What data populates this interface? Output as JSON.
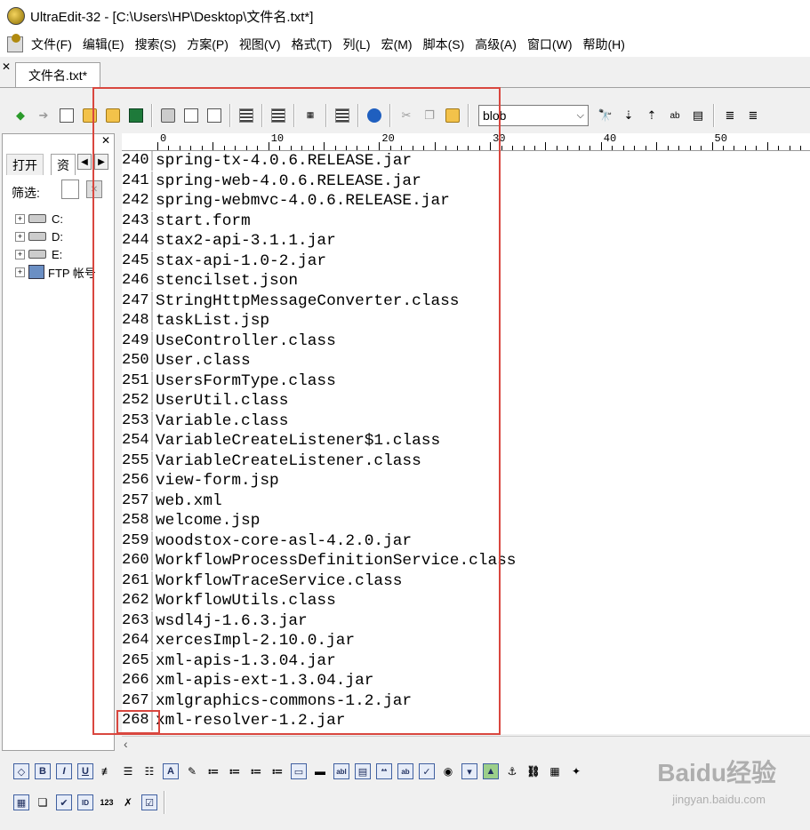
{
  "window": {
    "title": "UltraEdit-32 - [C:\\Users\\HP\\Desktop\\文件名.txt*]"
  },
  "menu": [
    "文件(F)",
    "编辑(E)",
    "搜索(S)",
    "方案(P)",
    "视图(V)",
    "格式(T)",
    "列(L)",
    "宏(M)",
    "脚本(S)",
    "高级(A)",
    "窗口(W)",
    "帮助(H)"
  ],
  "tab": {
    "label": "文件名.txt*"
  },
  "toolbar": {
    "search_value": "blob"
  },
  "left_panel": {
    "tab_open": "打开",
    "tab_resource": "资",
    "filter_label": "筛选:",
    "tree": [
      {
        "label": "C:",
        "icon": "drive-icon"
      },
      {
        "label": "D:",
        "icon": "drive-icon"
      },
      {
        "label": "E:",
        "icon": "drive-icon"
      },
      {
        "label": "FTP 帐号",
        "icon": "ftp-icon"
      }
    ]
  },
  "ruler": {
    "marks": [
      "0",
      "10",
      "20",
      "30",
      "40",
      "50"
    ]
  },
  "editor": {
    "lines": [
      {
        "num": "240",
        "text": "spring-tx-4.0.6.RELEASE.jar"
      },
      {
        "num": "241",
        "text": "spring-web-4.0.6.RELEASE.jar"
      },
      {
        "num": "242",
        "text": "spring-webmvc-4.0.6.RELEASE.jar"
      },
      {
        "num": "243",
        "text": "start.form"
      },
      {
        "num": "244",
        "text": "stax2-api-3.1.1.jar"
      },
      {
        "num": "245",
        "text": "stax-api-1.0-2.jar"
      },
      {
        "num": "246",
        "text": "stencilset.json"
      },
      {
        "num": "247",
        "text": "StringHttpMessageConverter.class"
      },
      {
        "num": "248",
        "text": "taskList.jsp"
      },
      {
        "num": "249",
        "text": "UseController.class"
      },
      {
        "num": "250",
        "text": "User.class"
      },
      {
        "num": "251",
        "text": "UsersFormType.class"
      },
      {
        "num": "252",
        "text": "UserUtil.class"
      },
      {
        "num": "253",
        "text": "Variable.class"
      },
      {
        "num": "254",
        "text": "VariableCreateListener$1.class"
      },
      {
        "num": "255",
        "text": "VariableCreateListener.class"
      },
      {
        "num": "256",
        "text": "view-form.jsp"
      },
      {
        "num": "257",
        "text": "web.xml"
      },
      {
        "num": "258",
        "text": "welcome.jsp"
      },
      {
        "num": "259",
        "text": "woodstox-core-asl-4.2.0.jar"
      },
      {
        "num": "260",
        "text": "WorkflowProcessDefinitionService.class"
      },
      {
        "num": "261",
        "text": "WorkflowTraceService.class"
      },
      {
        "num": "262",
        "text": "WorkflowUtils.class"
      },
      {
        "num": "263",
        "text": "wsdl4j-1.6.3.jar"
      },
      {
        "num": "264",
        "text": "xercesImpl-2.10.0.jar"
      },
      {
        "num": "265",
        "text": "xml-apis-1.3.04.jar"
      },
      {
        "num": "266",
        "text": "xml-apis-ext-1.3.04.jar"
      },
      {
        "num": "267",
        "text": "xmlgraphics-commons-1.2.jar"
      },
      {
        "num": "268",
        "text": "xml-resolver-1.2.jar"
      }
    ]
  },
  "watermark": {
    "brand": "Baidu经验",
    "url": "jingyan.baidu.com"
  },
  "colors": {
    "annotation": "#d9473f",
    "gutter_border": "#c8c8c8"
  }
}
